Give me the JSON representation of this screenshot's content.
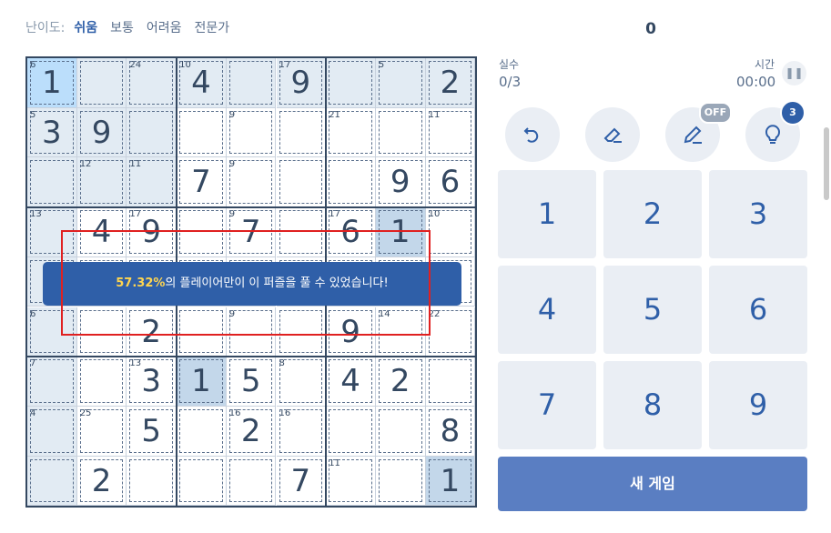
{
  "difficulty": {
    "label": "난이도:",
    "options": [
      "쉬움",
      "보통",
      "어려움",
      "전문가"
    ],
    "active": 0
  },
  "score": "0",
  "mistakes": {
    "label": "실수",
    "value": "0/3"
  },
  "timer": {
    "label": "시간",
    "value": "00:00",
    "pause_icon": "pause-icon"
  },
  "tools": [
    {
      "name": "undo",
      "icon": "undo-icon"
    },
    {
      "name": "erase",
      "icon": "eraser-icon"
    },
    {
      "name": "notes",
      "icon": "pencil-icon",
      "badge": "OFF"
    },
    {
      "name": "hint",
      "icon": "lightbulb-icon",
      "badge": "3"
    }
  ],
  "numpad": [
    "1",
    "2",
    "3",
    "4",
    "5",
    "6",
    "7",
    "8",
    "9"
  ],
  "new_game_label": "새 게임",
  "banner": {
    "percent": "57.32%",
    "text": "의 플레이어만이 이 퍼즐을 풀 수 있었습니다!"
  },
  "board": {
    "values": [
      [
        "1",
        "",
        "",
        "4",
        "",
        "9",
        "",
        "",
        "2"
      ],
      [
        "3",
        "9",
        "",
        "",
        "",
        "",
        "",
        "",
        ""
      ],
      [
        "",
        "",
        "",
        "7",
        "",
        "",
        "",
        "9",
        "6"
      ],
      [
        "",
        "4",
        "9",
        "",
        "7",
        "",
        "6",
        "1",
        ""
      ],
      [
        "",
        "",
        "",
        "",
        "",
        "",
        "",
        "",
        ""
      ],
      [
        "",
        "",
        "2",
        "",
        "",
        "",
        "9",
        "",
        ""
      ],
      [
        "",
        "",
        "3",
        "1",
        "5",
        "",
        "4",
        "2",
        ""
      ],
      [
        "",
        "",
        "5",
        "",
        "2",
        "",
        "",
        "",
        "8"
      ],
      [
        "",
        "2",
        "",
        "",
        "",
        "7",
        "",
        "",
        "1"
      ]
    ],
    "sums": [
      {
        "r": 0,
        "c": 0,
        "v": "6"
      },
      {
        "r": 0,
        "c": 2,
        "v": "24"
      },
      {
        "r": 0,
        "c": 3,
        "v": "10"
      },
      {
        "r": 0,
        "c": 5,
        "v": "17"
      },
      {
        "r": 0,
        "c": 7,
        "v": "5"
      },
      {
        "r": 1,
        "c": 0,
        "v": "5"
      },
      {
        "r": 1,
        "c": 4,
        "v": "9"
      },
      {
        "r": 1,
        "c": 6,
        "v": "21"
      },
      {
        "r": 1,
        "c": 8,
        "v": "11"
      },
      {
        "r": 2,
        "c": 1,
        "v": "12"
      },
      {
        "r": 2,
        "c": 2,
        "v": "11"
      },
      {
        "r": 2,
        "c": 4,
        "v": "9"
      },
      {
        "r": 3,
        "c": 0,
        "v": "13"
      },
      {
        "r": 3,
        "c": 2,
        "v": "17"
      },
      {
        "r": 3,
        "c": 4,
        "v": "9"
      },
      {
        "r": 3,
        "c": 6,
        "v": "17"
      },
      {
        "r": 3,
        "c": 8,
        "v": "10"
      },
      {
        "r": 5,
        "c": 0,
        "v": "6"
      },
      {
        "r": 5,
        "c": 4,
        "v": "9"
      },
      {
        "r": 5,
        "c": 7,
        "v": "14"
      },
      {
        "r": 5,
        "c": 8,
        "v": "22"
      },
      {
        "r": 6,
        "c": 0,
        "v": "7"
      },
      {
        "r": 6,
        "c": 2,
        "v": "13"
      },
      {
        "r": 6,
        "c": 5,
        "v": "8"
      },
      {
        "r": 7,
        "c": 0,
        "v": "4"
      },
      {
        "r": 7,
        "c": 1,
        "v": "25"
      },
      {
        "r": 7,
        "c": 4,
        "v": "16"
      },
      {
        "r": 7,
        "c": 5,
        "v": "16"
      },
      {
        "r": 8,
        "c": 6,
        "v": "11"
      }
    ],
    "selected": {
      "r": 0,
      "c": 0
    },
    "same_value_cells": [
      {
        "r": 3,
        "c": 7
      },
      {
        "r": 6,
        "c": 3
      },
      {
        "r": 8,
        "c": 8
      }
    ]
  }
}
